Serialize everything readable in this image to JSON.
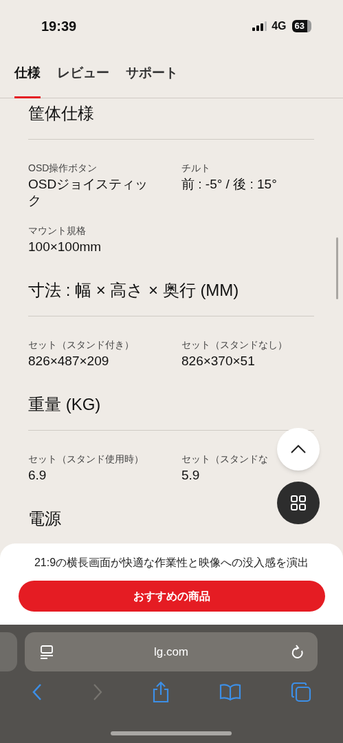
{
  "status_bar": {
    "time": "19:39",
    "network": "4G",
    "battery": "63"
  },
  "tabs": [
    {
      "label": "仕様",
      "selected": true
    },
    {
      "label": "レビュー",
      "selected": false
    },
    {
      "label": "サポート",
      "selected": false
    }
  ],
  "sections": [
    {
      "title": "筐体仕様",
      "specs": [
        {
          "label": "OSD操作ボタン",
          "value": "OSDジョイスティック"
        },
        {
          "label": "チルト",
          "value": "前 : -5° / 後 : 15°"
        },
        {
          "label": "マウント規格",
          "value": "100×100mm"
        }
      ]
    },
    {
      "title": "寸法 : 幅 × 高さ × 奥行 (MM)",
      "specs": [
        {
          "label": "セット（スタンド付き）",
          "value": "826×487×209"
        },
        {
          "label": "セット（スタンドなし）",
          "value": "826×370×51"
        }
      ]
    },
    {
      "title": "重量 (KG)",
      "specs": [
        {
          "label": "セット（スタンド使用時）",
          "value": "6.9"
        },
        {
          "label": "セット（スタンドな",
          "value": "5.9"
        }
      ]
    },
    {
      "title": "電源"
    }
  ],
  "promo": {
    "text": "21:9の横長画面が快適な作業性と映像への没入感を演出",
    "button": "おすすめの商品"
  },
  "browser": {
    "url": "lg.com"
  }
}
